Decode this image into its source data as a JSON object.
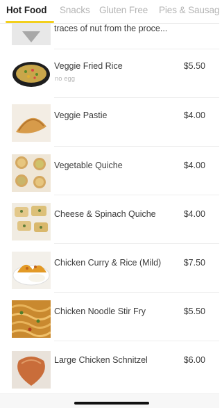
{
  "tabs": [
    {
      "label": "Hot Food",
      "active": true
    },
    {
      "label": "Snacks",
      "active": false
    },
    {
      "label": "Gluten Free",
      "active": false
    },
    {
      "label": "Pies & Sausag",
      "active": false
    }
  ],
  "colors": {
    "accent": "#f2cf1c",
    "tab_inactive": "#b3b3b3",
    "text": "#3b3b3b",
    "note": "#b8b8b8"
  },
  "partial_item": {
    "name": "traces of nut from the proce..."
  },
  "items": [
    {
      "name": "Veggie Fried Rice",
      "note": "no egg",
      "price": "$5.50"
    },
    {
      "name": "Veggie Pastie",
      "note": "",
      "price": "$4.00"
    },
    {
      "name": "Vegetable Quiche",
      "note": "",
      "price": "$4.00"
    },
    {
      "name": "Cheese & Spinach Quiche",
      "note": "",
      "price": "$4.00"
    },
    {
      "name": "Chicken Curry &  Rice (Mild)",
      "note": "",
      "price": "$7.50"
    },
    {
      "name": "Chicken Noodle Stir Fry",
      "note": "",
      "price": "$5.50"
    },
    {
      "name": "Large Chicken Schnitzel",
      "note": "",
      "price": "$6.00"
    }
  ]
}
